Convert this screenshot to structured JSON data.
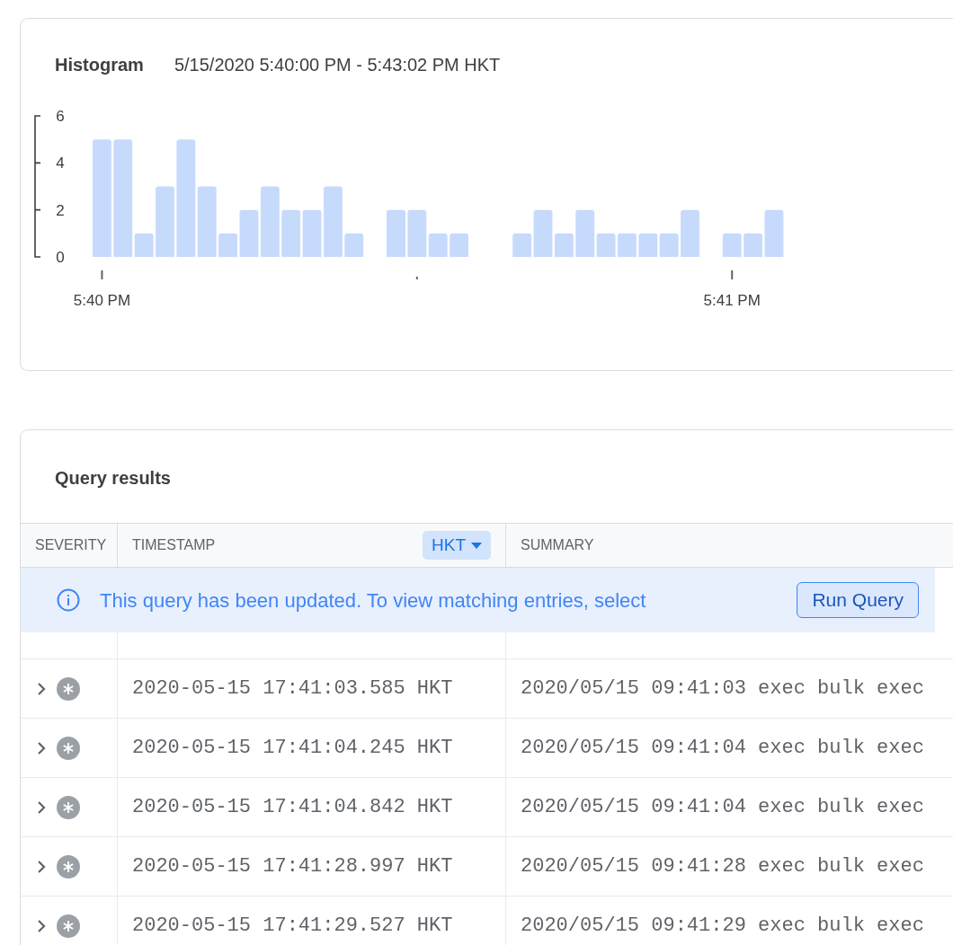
{
  "histogram": {
    "title": "Histogram",
    "range": "5/15/2020 5:40:00 PM - 5:43:02 PM HKT",
    "chart_data": {
      "type": "bar",
      "categories": [
        "5:40 PM",
        null,
        null,
        null,
        null,
        null,
        null,
        null,
        null,
        null,
        null,
        null,
        null,
        null,
        null,
        null,
        null,
        null,
        null,
        null,
        null,
        null,
        null,
        null,
        null,
        null,
        null,
        null,
        null,
        null,
        "5:41 PM",
        null,
        null
      ],
      "values": [
        5,
        5,
        1,
        3,
        5,
        3,
        1,
        2,
        3,
        2,
        2,
        3,
        1,
        null,
        2,
        2,
        1,
        1,
        null,
        null,
        1,
        2,
        1,
        2,
        1,
        1,
        1,
        1,
        2,
        null,
        1,
        1,
        2
      ],
      "ylim": [
        0,
        6
      ],
      "yticks": [
        0,
        2,
        4,
        6
      ]
    }
  },
  "query_results": {
    "title": "Query results",
    "columns": [
      {
        "label": "SEVERITY"
      },
      {
        "label": "TIMESTAMP"
      },
      {
        "label": "SUMMARY"
      }
    ],
    "timezone_button": "HKT",
    "banner": {
      "message": "This query has been updated. To view matching entries, select",
      "button": "Run Query"
    },
    "rows": [
      {
        "timestamp": "2020-05-15 17:41:03.585 HKT",
        "summary": "2020/05/15 09:41:03 exec bulk exec"
      },
      {
        "timestamp": "2020-05-15 17:41:04.245 HKT",
        "summary": "2020/05/15 09:41:04 exec bulk exec"
      },
      {
        "timestamp": "2020-05-15 17:41:04.842 HKT",
        "summary": "2020/05/15 09:41:04 exec bulk exec"
      },
      {
        "timestamp": "2020-05-15 17:41:28.997 HKT",
        "summary": "2020/05/15 09:41:28 exec bulk exec"
      },
      {
        "timestamp": "2020-05-15 17:41:29.527 HKT",
        "summary": "2020/05/15 09:41:29 exec bulk exec"
      }
    ]
  }
}
